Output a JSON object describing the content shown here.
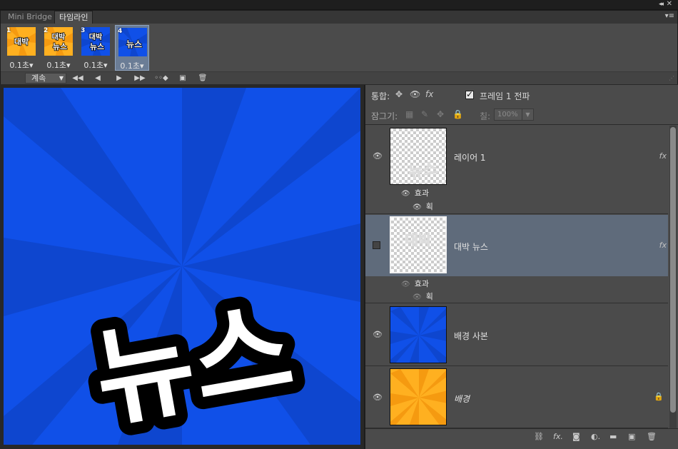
{
  "colors": {
    "canvas_blue": "#1050e8",
    "ray_blue": "#0e46cf",
    "bg_orange": "#ffb020",
    "panel": "#4b4b4b",
    "selection": "#5f6b7b"
  },
  "window": {
    "collapse_icon": "double-chevron-left-icon",
    "close_icon": "close-icon"
  },
  "tabs": [
    {
      "label": "Mini Bridge",
      "active": false
    },
    {
      "label": "타임라인",
      "active": true
    }
  ],
  "frames": [
    {
      "num": "1",
      "time": "0.1초",
      "bg": "orange",
      "text": "대박",
      "selected": false
    },
    {
      "num": "2",
      "time": "0.1초",
      "bg": "orange",
      "text": "대박 뉴스",
      "selected": false
    },
    {
      "num": "3",
      "time": "0.1초",
      "bg": "blue",
      "text": "대박 뉴스",
      "selected": false
    },
    {
      "num": "4",
      "time": "0.1초",
      "bg": "blue",
      "text": "뉴스",
      "selected": true
    }
  ],
  "timeline_controls": {
    "loop_label": "계속",
    "buttons": [
      "first-frame-icon",
      "prev-frame-icon",
      "play-icon",
      "next-frame-icon",
      "tween-icon",
      "duplicate-frame-icon",
      "trash-icon"
    ]
  },
  "canvas": {
    "text": "뉴스"
  },
  "layers_panel": {
    "unify_label": "통합:",
    "propagate_label": "프레임 1 전파",
    "propagate_checked": true,
    "lock_label": "잠그기:",
    "fill_label": "칠:",
    "fill_value": "100%"
  },
  "layers": [
    {
      "name": "레이어 1",
      "visible": true,
      "selected": false,
      "has_fx": true,
      "effects_label": "효과",
      "effect_item": "획",
      "thumb": "checker-text",
      "thumb_text": "뉴스"
    },
    {
      "name": "대박 뉴스",
      "visible": false,
      "selected": true,
      "has_fx": true,
      "effects_label": "효과",
      "effect_item": "획",
      "thumb": "checker-text",
      "thumb_text": "대박"
    },
    {
      "name": "배경 사본",
      "visible": true,
      "selected": false,
      "has_fx": false,
      "thumb": "blue"
    },
    {
      "name": "배경",
      "visible": true,
      "selected": false,
      "has_fx": false,
      "locked": true,
      "thumb": "orange",
      "italic": true
    }
  ],
  "bottom_icons": [
    "link-icon",
    "fx-icon",
    "mask-icon",
    "adjustment-icon",
    "folder-icon",
    "new-layer-icon",
    "trash-icon"
  ]
}
